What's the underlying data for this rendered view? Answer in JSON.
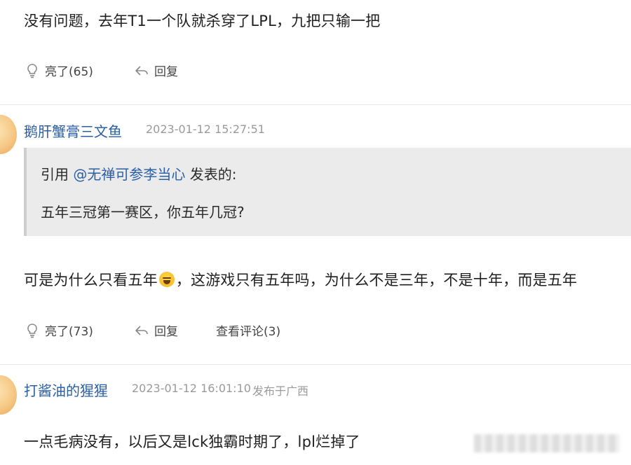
{
  "comments": [
    {
      "text": "没有问题，去年T1一个队就杀穿了LPL，九把只输一把",
      "like_label": "亮了(65)",
      "reply_label": "回复"
    },
    {
      "username": "鹅肝蟹膏三文鱼",
      "timestamp": "2023-01-12 15:27:51",
      "quote": {
        "prefix": "引用 ",
        "mention": "@无禅可参李当心",
        "suffix": " 发表的:",
        "text": "五年三冠第一赛区，你五年几冠?"
      },
      "text_before_emoji": "可是为什么只看五年",
      "emoji": "laughing-crying-emoji",
      "text_after_emoji": "，这游戏只有五年吗，为什么不是三年，不是十年，而是五年",
      "like_label": "亮了(73)",
      "reply_label": "回复",
      "view_replies_label": "查看评论(3)"
    },
    {
      "username": "打酱油的猩猩",
      "timestamp": "2023-01-12 16:01:10",
      "location": "发布于广西",
      "text": "一点毛病没有，以后又是lck独霸时期了，lpl烂掉了"
    }
  ],
  "colors": {
    "username": "#2b5fa6",
    "meta": "#9a9a9a",
    "quote_bg": "#ebebeb",
    "divider": "#e6e6e6"
  }
}
